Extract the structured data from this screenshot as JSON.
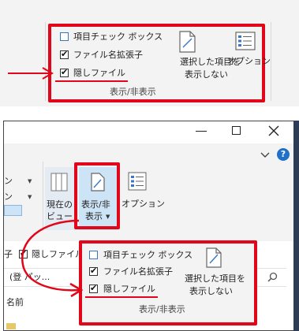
{
  "top": {
    "items": [
      {
        "label": "項目チェック ボックス",
        "checked": false
      },
      {
        "label": "ファイル名拡張子",
        "checked": true
      },
      {
        "label": "隠しファイル",
        "checked": true
      }
    ],
    "hide_selected_line1": "選択した項目を",
    "hide_selected_line2": "表示しない",
    "options_label": "オプション",
    "group_label": "表示/非表示"
  },
  "window": {
    "left_truncated_1": "ン",
    "left_truncated_2": "ン",
    "current_view_line1": "現在の",
    "current_view_line2": "ビュー",
    "show_hide_line1": "表示/非",
    "show_hide_line2": "表示",
    "options_label": "オプション",
    "ext_truncated": "子",
    "hidden_truncated": "隠しファイル",
    "address_text": "(登 パッ...",
    "name_header": "名前"
  },
  "bottom_popup": {
    "items": [
      {
        "label": "項目チェック ボックス",
        "checked": false
      },
      {
        "label": "ファイル名拡張子",
        "checked": true
      },
      {
        "label": "隠しファイル",
        "checked": true
      }
    ],
    "hide_selected_line1": "選択した項目を",
    "hide_selected_line2": "表示しない",
    "group_label": "表示/非表示"
  },
  "colors": {
    "annotation_red": "#e1061a",
    "titlebar": "#ffffff",
    "checkbox_blue": "#3a76c4"
  }
}
